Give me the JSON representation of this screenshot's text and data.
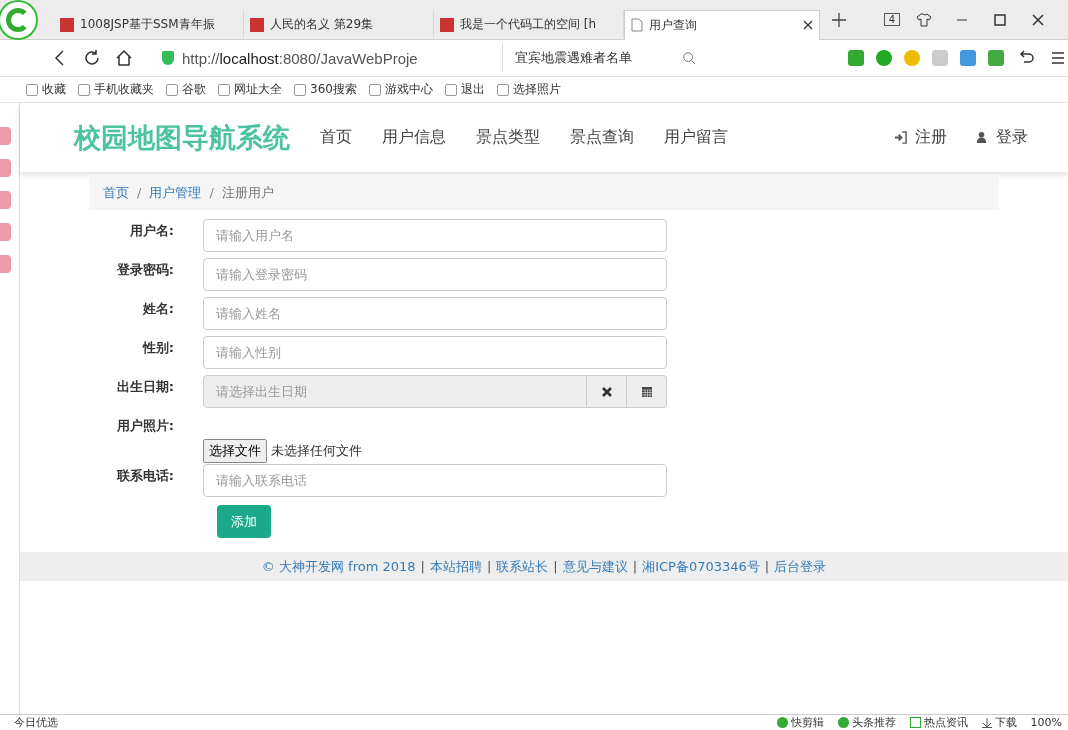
{
  "browser": {
    "tabs": [
      {
        "title": "1008JSP基于SSM青年振",
        "selected": false
      },
      {
        "title": "人民的名义 第29集",
        "selected": false
      },
      {
        "title": "我是一个代码工的空间 [h",
        "selected": false
      },
      {
        "title": "用户查询",
        "selected": true
      }
    ],
    "tab_count": "4",
    "address_prefix": "http://",
    "address_host": "localhost",
    "address_rest": ":8080/JavaWebProje",
    "search_text": "宜宾地震遇难者名单",
    "bookmarks": [
      "收藏",
      "手机收藏夹",
      "谷歌",
      "网址大全",
      "360搜索",
      "游戏中心",
      "退出",
      "选择照片"
    ]
  },
  "site": {
    "title": "校园地图导航系统",
    "nav": [
      {
        "label": "首页"
      },
      {
        "label": "用户信息"
      },
      {
        "label": "景点类型"
      },
      {
        "label": "景点查询"
      },
      {
        "label": "用户留言"
      }
    ],
    "auth": [
      {
        "label": "注册",
        "kind": "signin"
      },
      {
        "label": "登录",
        "kind": "user"
      }
    ],
    "breadcrumb": {
      "separator": "/",
      "links": [
        "首页",
        "用户管理"
      ],
      "current": "注册用户"
    },
    "form": [
      {
        "label": "用户名:",
        "kind": "text",
        "placeholder": "请输入用户名"
      },
      {
        "label": "登录密码:",
        "kind": "text",
        "placeholder": "请输入登录密码"
      },
      {
        "label": "姓名:",
        "kind": "text",
        "placeholder": "请输入姓名"
      },
      {
        "label": "性别:",
        "kind": "text",
        "placeholder": "请输入性别"
      },
      {
        "label": "出生日期:",
        "kind": "date",
        "placeholder": "请选择出生日期"
      },
      {
        "label": "用户照片:",
        "kind": "file",
        "button": "选择文件",
        "status": "未选择任何文件"
      },
      {
        "label": "联系电话:",
        "kind": "text",
        "placeholder": "请输入联系电话"
      }
    ],
    "submit": "添加",
    "footer": {
      "copyright": "© 大神开发网 from 2018",
      "separator": "|",
      "links": [
        "本站招聘",
        "联系站长",
        "意见与建议",
        "湘ICP备0703346号",
        "后台登录"
      ]
    }
  },
  "status_bar": {
    "left": "今日优选",
    "items": [
      {
        "label": "快剪辑",
        "kind": "play"
      },
      {
        "label": "头条推荐",
        "kind": "play"
      },
      {
        "label": "热点资讯",
        "kind": "news"
      },
      {
        "label": "下载",
        "kind": "download"
      }
    ],
    "zoom": "100%"
  }
}
